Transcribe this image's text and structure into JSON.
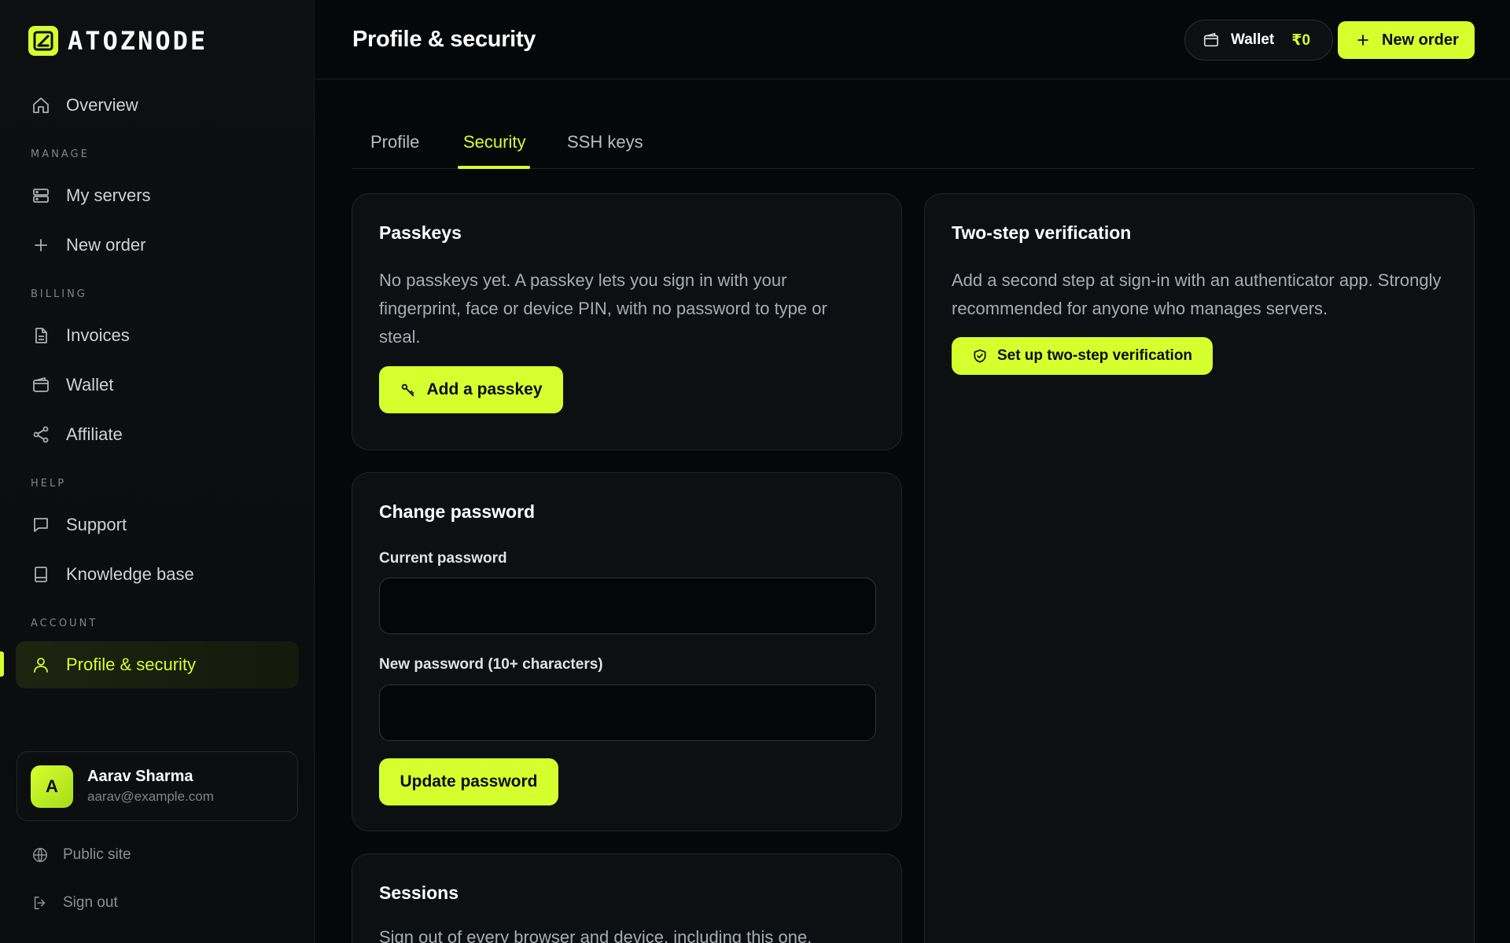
{
  "brand": {
    "name": "ATOZNODE"
  },
  "sidebar": {
    "overview": "Overview",
    "sections": {
      "manage": "MANAGE",
      "billing": "BILLING",
      "help": "HELP",
      "account": "ACCOUNT"
    },
    "items": {
      "my_servers": "My servers",
      "new_order": "New order",
      "invoices": "Invoices",
      "wallet": "Wallet",
      "affiliate": "Affiliate",
      "support": "Support",
      "knowledge_base": "Knowledge base",
      "profile_security": "Profile & security"
    },
    "user": {
      "initial": "A",
      "name": "Aarav Sharma",
      "email": "aarav@example.com"
    },
    "footer": {
      "public_site": "Public site",
      "sign_out": "Sign out"
    }
  },
  "header": {
    "title": "Profile & security",
    "wallet_label": "Wallet",
    "wallet_amount": "₹0",
    "new_order_label": "New order"
  },
  "tabs": {
    "profile": "Profile",
    "security": "Security",
    "ssh_keys": "SSH keys"
  },
  "passkeys": {
    "title": "Passkeys",
    "description": "No passkeys yet. A passkey lets you sign in with your fingerprint, face or device PIN, with no password to type or steal.",
    "button": "Add a passkey"
  },
  "change_password": {
    "title": "Change password",
    "current_label": "Current password",
    "current_value": "",
    "new_label": "New password (10+ characters)",
    "new_value": "",
    "button": "Update password"
  },
  "sessions": {
    "title": "Sessions",
    "description": "Sign out of every browser and device, including this one."
  },
  "two_step": {
    "title": "Two-step verification",
    "description": "Add a second step at sign-in with an authenticator app. Strongly recommended for anyone who manages servers.",
    "button": "Set up two-step verification"
  },
  "colors": {
    "accent": "#d6ff2e",
    "background": "#060708",
    "card": "#0d1013"
  }
}
